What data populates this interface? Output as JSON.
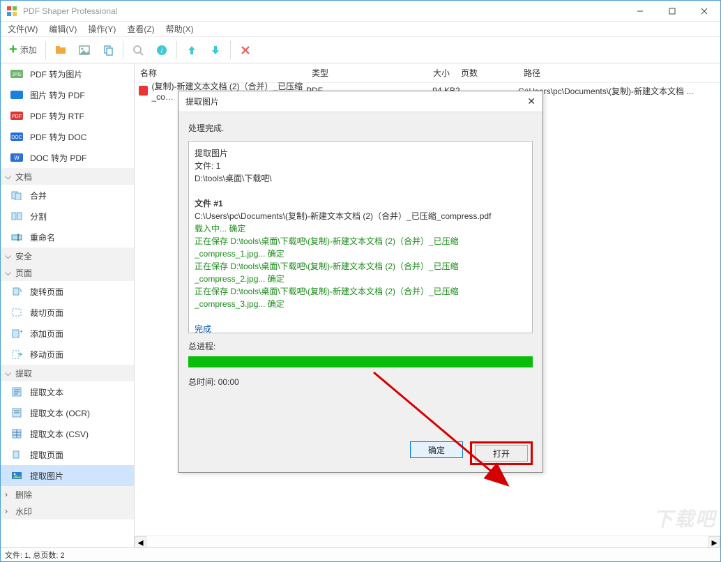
{
  "title": "PDF Shaper Professional",
  "menu": {
    "file": "文件(W)",
    "edit": "编辑(V)",
    "operate": "操作(Y)",
    "view": "查看(Z)",
    "help": "帮助(X)"
  },
  "toolbar": {
    "add": "添加"
  },
  "sidebar": {
    "items_top": [
      {
        "label": "PDF 转为图片",
        "color": "#6fb56f"
      },
      {
        "label": "图片 转为 PDF",
        "color": "#1b7fe0"
      },
      {
        "label": "PDF 转为 RTF",
        "color": "#e03535"
      },
      {
        "label": "PDF 转为 DOC",
        "color": "#2a6fd6"
      },
      {
        "label": "DOC 转为 PDF",
        "color": "#2a6fd6"
      }
    ],
    "sec_doc": "文档",
    "doc_items": [
      "合并",
      "分割",
      "重命名"
    ],
    "sec_sec": "安全",
    "sec_page": "页面",
    "page_items": [
      "旋转页面",
      "裁切页面",
      "添加页面",
      "移动页面"
    ],
    "sec_extract": "提取",
    "ext_items": [
      "提取文本",
      "提取文本 (OCR)",
      "提取文本 (CSV)",
      "提取页面",
      "提取图片"
    ],
    "sec_del": "删除",
    "sec_wm": "水印"
  },
  "columns": {
    "name": "名称",
    "type": "类型",
    "size": "大小",
    "pages": "页数",
    "path": "路径"
  },
  "row": {
    "name": "(复制)-新建文本文档 (2)（合并）_已压缩_co…",
    "type": "PDF",
    "size": "94 KB",
    "pages": "2",
    "path": "C:\\Users\\pc\\Documents\\(复制)-新建文本文档 ..."
  },
  "statusbar": "文件: 1, 总页数: 2",
  "dialog": {
    "title": "提取图片",
    "status": "处理完成.",
    "log": {
      "l1": "提取图片",
      "l2": "文件: 1",
      "l3": "D:\\tools\\桌面\\下载吧\\",
      "l4": "文件 #1",
      "l5": "C:\\Users\\pc\\Documents\\(复制)-新建文本文档 (2)（合并）_已压缩_compress.pdf",
      "l6a": "载入中...",
      "l6b": "确定",
      "l7a": "正在保存 D:\\tools\\桌面\\下载吧\\(复制)-新建文本文档 (2)（合并）_已压缩_compress_1.jpg...",
      "l7b": "确定",
      "l8a": "正在保存 D:\\tools\\桌面\\下载吧\\(复制)-新建文本文档 (2)（合并）_已压缩_compress_2.jpg...",
      "l8b": "确定",
      "l9a": "正在保存 D:\\tools\\桌面\\下载吧\\(复制)-新建文本文档 (2)（合并）_已压缩_compress_3.jpg...",
      "l9b": "确定",
      "l10": "完成"
    },
    "progress_label": "总进程:",
    "time": "总时间: 00:00",
    "ok": "确定",
    "open": "打开"
  },
  "watermark": "下载吧"
}
